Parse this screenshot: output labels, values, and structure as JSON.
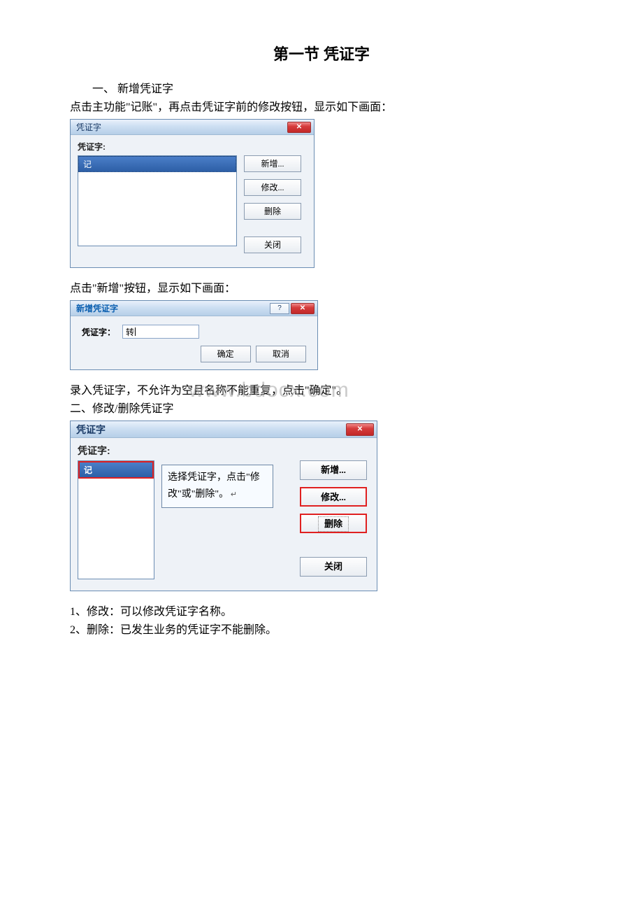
{
  "heading": "第一节 凭证字",
  "section1_title": "一、 新增凭证字",
  "section1_intro": "点击主功能\"记账\"，再点击凭证字前的修改按钮，显示如下画面：",
  "dialog1": {
    "title": "凭证字",
    "label": "凭证字:",
    "item": "记",
    "btn_add": "新增...",
    "btn_edit": "修改...",
    "btn_delete": "删除",
    "btn_close": "关闭"
  },
  "after_d1": "点击\"新增\"按钮，显示如下画面：",
  "dialog2": {
    "title": "新增凭证字",
    "label": "凭证字：",
    "value": "转",
    "btn_ok": "确定",
    "btn_cancel": "取消"
  },
  "after_d2_line1": "录入凭证字，不允许为空且名称不能重复，点击\"确定\"。",
  "section2_title": "二、修改/删除凭证字",
  "watermark": "www.bdocx.com",
  "dialog3": {
    "title": "凭证字",
    "label": "凭证字:",
    "item": "记",
    "callout": "选择凭证字，点击\"修改\"或\"删除\"。",
    "btn_add": "新增...",
    "btn_edit": "修改...",
    "btn_delete": "删除",
    "btn_close": "关闭"
  },
  "note1": "1、修改：可以修改凭证字名称。",
  "note2": "2、删除：已发生业务的凭证字不能删除。"
}
